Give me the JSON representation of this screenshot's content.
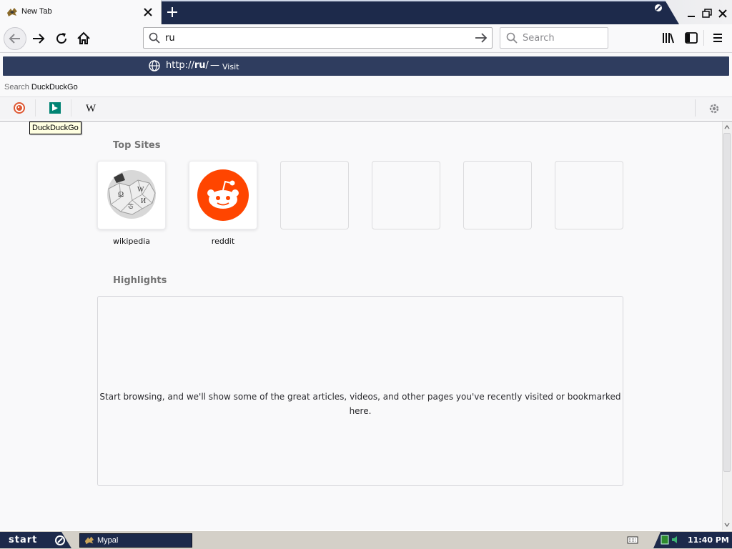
{
  "tab": {
    "title": "New Tab"
  },
  "urlbar": {
    "value": "ru"
  },
  "searchbar": {
    "placeholder": "Search"
  },
  "autocomplete": {
    "url_prefix": "http://",
    "url_bold": "ru",
    "url_suffix": "/",
    "separator": "—",
    "action": "Visit",
    "search_with_label": "Search",
    "search_with_engine": "DuckDuckGo",
    "engines": [
      "DuckDuckGo",
      "Bing",
      "Wikipedia"
    ],
    "tooltip": "DuckDuckGo"
  },
  "newtab": {
    "top_sites_title": "Top Sites",
    "top_sites": [
      {
        "label": "wikipedia",
        "icon": "wikipedia-globe-icon"
      },
      {
        "label": "reddit",
        "icon": "reddit-alien-icon"
      }
    ],
    "highlights_title": "Highlights",
    "highlights_empty": "Start browsing, and we'll show some of the great articles, videos, and other pages you've recently visited or bookmarked here."
  },
  "taskbar": {
    "start_label": "start",
    "task_label": "Mypal",
    "clock": "11:40 PM"
  },
  "colors": {
    "titlebar": "#1d2a4b",
    "selection": "#2f3d5f",
    "reddit": "#ff4500",
    "bing": "#008373"
  }
}
